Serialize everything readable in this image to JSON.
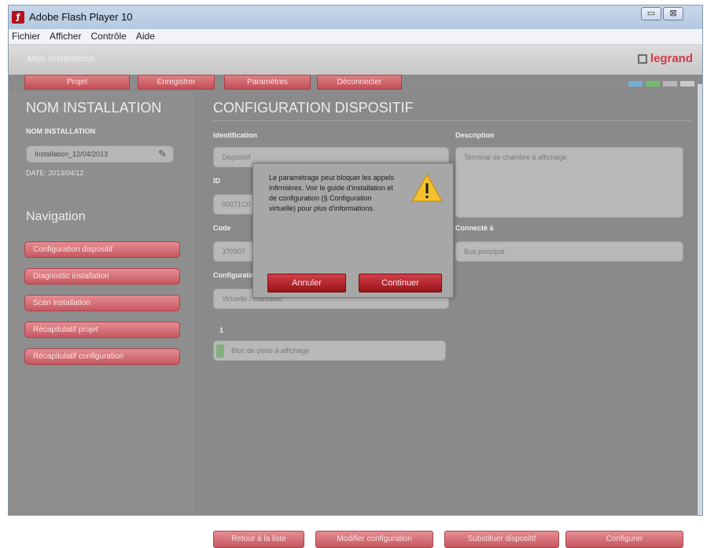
{
  "window": {
    "title": "Adobe Flash Player 10",
    "icon": "flash-icon",
    "controls": {
      "minimize_icon": "minimize-icon",
      "maximize_icon": "maximize-icon"
    }
  },
  "menubar": {
    "items": [
      "Fichier",
      "Afficher",
      "Contrôle",
      "Aide"
    ]
  },
  "header": {
    "app_title": "Mon Installation",
    "logo": "legrand"
  },
  "topnav": {
    "buttons": [
      "Projet",
      "Enregistrer",
      "Paramètres",
      "Déconnecter"
    ],
    "swatch_colors": [
      "#6fb0d8",
      "#6fbf6f",
      "#b7b7b7",
      "#c9c9c9"
    ]
  },
  "sidebar": {
    "heading": "NOM INSTALLATION",
    "field_label": "NOM INSTALLATION",
    "installation_name": "Installation_12/04/2013",
    "edit_icon": "pencil-icon",
    "date": "DATE: 2013/04/12",
    "nav_heading": "Navigation",
    "nav_items": [
      "Configuration dispositif",
      "Diagnostic installation",
      "Scan installation",
      "Récapitulatif projet",
      "Récapitulatif configuration"
    ]
  },
  "main": {
    "heading": "CONFIGURATION DISPOSITIF",
    "identification_label": "Identification",
    "identification_value": "Dispositif",
    "id_label": "ID",
    "id_value": "00071C0",
    "code_label": "Code",
    "code_value": "370907",
    "configuration_label": "Configuration",
    "configuration_value": "Virtuelle / manuelle",
    "description_label": "Description",
    "description_value": "Terminal de chambre à affichage",
    "connected_label": "Connecté à",
    "connected_value": "Bus principal",
    "item_number": "1",
    "item_value": "Bloc de porte à affichage",
    "bottom_buttons": [
      "Retour à la liste",
      "Modifier configuration",
      "Substituer dispositif",
      "Configurer"
    ]
  },
  "dialog": {
    "message": "Le paramétrage peut bloquer les appels infirmières. Voir le guide d'installation et de configuration (§ Configuration virtuelle) pour plus d'informations.",
    "warning_icon": "warning-icon",
    "cancel_label": "Annuler",
    "continue_label": "Continuer"
  }
}
